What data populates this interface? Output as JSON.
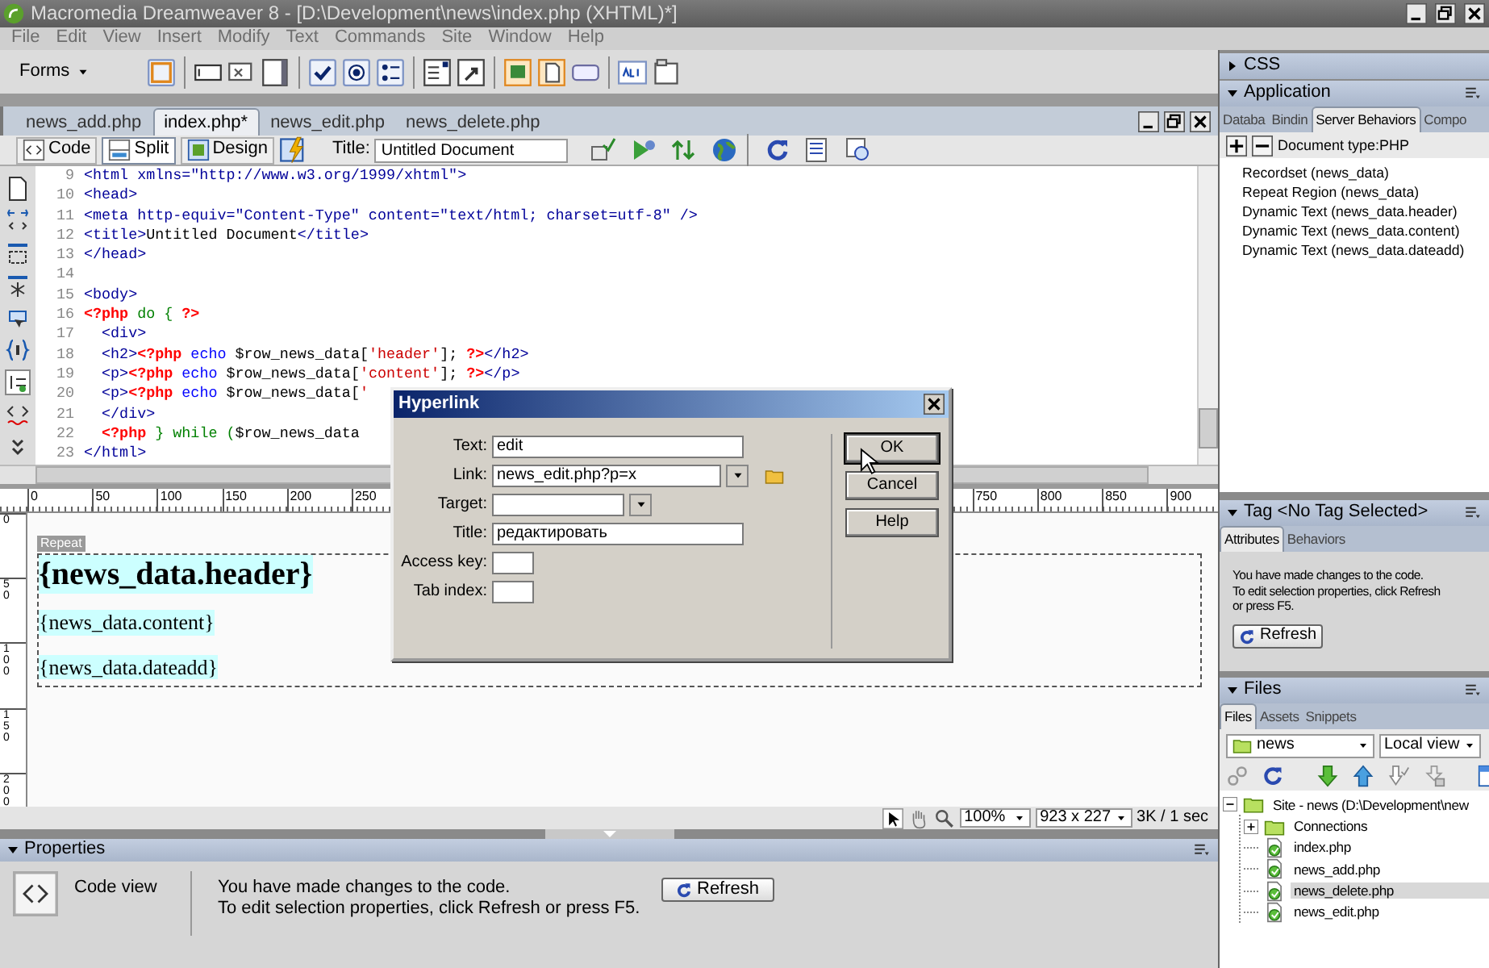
{
  "window": {
    "title": "Macromedia Dreamweaver 8 - [D:\\Development\\news\\index.php (XHTML)*]"
  },
  "menu": [
    "File",
    "Edit",
    "View",
    "Insert",
    "Modify",
    "Text",
    "Commands",
    "Site",
    "Window",
    "Help"
  ],
  "insert_bar": {
    "category": "Forms"
  },
  "document_tabs": [
    {
      "label": "news_add.php",
      "selected": false
    },
    {
      "label": "index.php*",
      "selected": true
    },
    {
      "label": "news_edit.php",
      "selected": false
    },
    {
      "label": "news_delete.php",
      "selected": false
    }
  ],
  "view_buttons": [
    {
      "label": "Code",
      "selected": false
    },
    {
      "label": "Split",
      "selected": true
    },
    {
      "label": "Design",
      "selected": false
    }
  ],
  "title_field": {
    "label": "Title:",
    "value": "Untitled Document"
  },
  "code": {
    "lines": [
      {
        "number": "9",
        "tokens": [
          {
            "kind": "tag",
            "text": "<html xmlns=\"http://www.w3.org/1999/xhtml\">"
          }
        ]
      },
      {
        "number": "10",
        "tokens": [
          {
            "kind": "tag",
            "text": "<head>"
          }
        ]
      },
      {
        "number": "11",
        "tokens": [
          {
            "kind": "tag",
            "text": "<meta http-equiv=\"Content-Type\" content=\"text/html; charset=utf-8\" />"
          }
        ]
      },
      {
        "number": "12",
        "tokens": [
          {
            "kind": "tag",
            "text": "<title>"
          },
          {
            "kind": "text",
            "text": "Untitled Document"
          },
          {
            "kind": "tag",
            "text": "</title>"
          }
        ]
      },
      {
        "number": "13",
        "tokens": [
          {
            "kind": "tag",
            "text": "</head>"
          }
        ]
      },
      {
        "number": "14"
      },
      {
        "number": "15",
        "tokens": [
          {
            "kind": "tag",
            "text": "<body>"
          }
        ]
      },
      {
        "number": "16",
        "tokens": [
          {
            "kind": "php",
            "text": "<?php"
          },
          {
            "kind": "control",
            "text": " do { "
          },
          {
            "kind": "php",
            "text": "?>"
          }
        ]
      },
      {
        "number": "17",
        "tokens": [
          {
            "kind": "tag",
            "text": "  <div>"
          }
        ]
      },
      {
        "number": "18",
        "tokens": [
          {
            "kind": "tag",
            "text": "  <h2>"
          },
          {
            "kind": "php",
            "text": "<?php"
          },
          {
            "kind": "keyword",
            "text": " echo "
          },
          {
            "kind": "text",
            "text": "$row_news_data["
          },
          {
            "kind": "string",
            "text": "'header'"
          },
          {
            "kind": "text",
            "text": "]; "
          },
          {
            "kind": "php",
            "text": "?>"
          },
          {
            "kind": "tag",
            "text": "</h2>"
          }
        ]
      },
      {
        "number": "19",
        "tokens": [
          {
            "kind": "tag",
            "text": "  <p>"
          },
          {
            "kind": "php",
            "text": "<?php"
          },
          {
            "kind": "keyword",
            "text": " echo "
          },
          {
            "kind": "text",
            "text": "$row_news_data["
          },
          {
            "kind": "string",
            "text": "'content'"
          },
          {
            "kind": "text",
            "text": "]; "
          },
          {
            "kind": "php",
            "text": "?>"
          },
          {
            "kind": "tag",
            "text": "</p>"
          }
        ]
      },
      {
        "number": "20",
        "tokens": [
          {
            "kind": "tag",
            "text": "  <p>"
          },
          {
            "kind": "php",
            "text": "<?php"
          },
          {
            "kind": "keyword",
            "text": " echo "
          },
          {
            "kind": "text",
            "text": "$row_news_data["
          },
          {
            "kind": "string",
            "text": "'"
          }
        ]
      },
      {
        "number": "21",
        "tokens": [
          {
            "kind": "tag",
            "text": "  </div>"
          }
        ]
      },
      {
        "number": "22",
        "tokens": [
          {
            "kind": "php",
            "text": "  <?php"
          },
          {
            "kind": "control",
            "text": " } while ("
          },
          {
            "kind": "text",
            "text": "$row_news_data"
          }
        ]
      },
      {
        "number": "23",
        "tokens": [
          {
            "kind": "tag",
            "text": "</html>"
          }
        ]
      }
    ]
  },
  "ruler": {
    "left_labels": [
      "0",
      "50",
      "100",
      "150",
      "200",
      "250"
    ],
    "right_labels": [
      "750",
      "800",
      "850",
      "900"
    ],
    "vertical_labels": [
      "0",
      "50",
      "100",
      "150",
      "200"
    ]
  },
  "design": {
    "repeat_label": "Repeat",
    "header": "{news_data.header}",
    "content": "{news_data.content}",
    "dateadd": "{news_data.dateadd}"
  },
  "status_bar": {
    "zoom": "100%",
    "size": "923 x 227",
    "download": "3K / 1 sec"
  },
  "properties": {
    "title": "Properties",
    "expanded": true,
    "mode": "Code view",
    "message_lines": [
      "You have made changes to the code.",
      "To edit selection properties, click Refresh or press F5."
    ],
    "button": "Refresh"
  },
  "dialog": {
    "title": "Hyperlink",
    "fields": [
      {
        "label": "Text:",
        "kind": "text",
        "value": "edit"
      },
      {
        "label": "Link:",
        "kind": "combo",
        "value": "news_edit.php?p=x"
      },
      {
        "label": "Target:",
        "kind": "select"
      },
      {
        "label": "Title:",
        "kind": "text",
        "value": "редактировать"
      },
      {
        "label": "Access key:",
        "kind": "short"
      },
      {
        "label": "Tab index:",
        "kind": "short"
      }
    ],
    "buttons": [
      "OK",
      "Cancel",
      "Help"
    ]
  },
  "css_panel": {
    "title": "CSS",
    "expanded": false
  },
  "application_panel": {
    "title": "Application",
    "expanded": true,
    "tabs": [
      {
        "label": "Databa",
        "selected": false
      },
      {
        "label": "Bindin",
        "selected": false
      },
      {
        "label": "Server Behaviors",
        "selected": true
      },
      {
        "label": "Compo",
        "selected": false
      }
    ],
    "document_type": "Document type:PHP",
    "behaviors": [
      "Recordset (news_data)",
      "Repeat Region (news_data)",
      "Dynamic Text (news_data.header)",
      "Dynamic Text (news_data.content)",
      "Dynamic Text (news_data.dateadd)"
    ]
  },
  "tag_panel": {
    "title": "Tag <No Tag Selected>",
    "expanded": true,
    "tabs": [
      {
        "label": "Attributes",
        "selected": true
      },
      {
        "label": "Behaviors",
        "selected": false
      }
    ],
    "message_lines": [
      "You have made changes to the code.",
      "To edit selection properties, click Refresh",
      "or press F5."
    ],
    "button": "Refresh"
  },
  "files_panel": {
    "title": "Files",
    "expanded": true,
    "tabs": [
      {
        "label": "Files",
        "selected": true
      },
      {
        "label": "Assets",
        "selected": false
      },
      {
        "label": "Snippets",
        "selected": false
      }
    ],
    "site": "news",
    "view": "Local view",
    "tree": [
      {
        "label": "Site - news (D:\\Development\\new",
        "kind": "site",
        "expanded": true,
        "selected": false,
        "children": [
          {
            "label": "Connections",
            "kind": "folder",
            "expanded": false,
            "selected": false
          },
          {
            "label": "index.php",
            "kind": "file",
            "selected": false
          },
          {
            "label": "news_add.php",
            "kind": "file",
            "selected": false
          },
          {
            "label": "news_delete.php",
            "kind": "file",
            "selected": true
          },
          {
            "label": "news_edit.php",
            "kind": "file",
            "selected": false
          }
        ]
      }
    ]
  }
}
